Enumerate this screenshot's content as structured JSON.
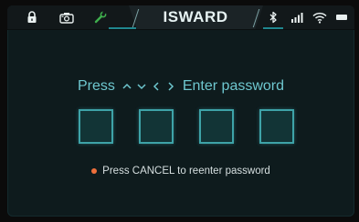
{
  "header": {
    "title": "ISWARD",
    "left_icons": [
      "lock-icon",
      "camera-icon",
      "wrench-icon"
    ],
    "right_icons": [
      "bluetooth-icon",
      "signal-icon",
      "wifi-icon",
      "battery-icon"
    ]
  },
  "prompt": {
    "press_label": "Press",
    "arrows": [
      "^",
      "v",
      "<",
      ">"
    ],
    "action_label": "Enter password"
  },
  "pins": {
    "count": 4
  },
  "hint": {
    "text": "Press CANCEL to reenter password"
  },
  "colors": {
    "accent": "#3ea3a8",
    "prompt_text": "#6ec7cf",
    "hint_dot": "#ee6f3b"
  }
}
